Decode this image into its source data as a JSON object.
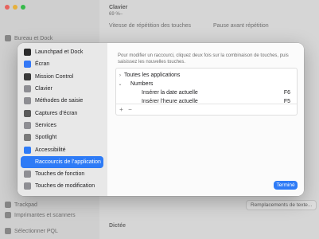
{
  "background": {
    "sidebar_items": [
      "Bureau et Dock",
      "Trackpad",
      "Imprimantes et scanners",
      "Sélectionner PQL"
    ],
    "main_title": "Clavier",
    "main_subtitle": "69 % ̶",
    "label_repeat": "Vitesse de répétition des touches",
    "label_delay": "Pause avant répétition",
    "button_replacements": "Remplacements de texte...",
    "section_dictation": "Dictée"
  },
  "dialog": {
    "sidebar": [
      {
        "label": "Launchpad et Dock",
        "icon": "launchpad-dock-icon",
        "color": "#2b2b2b"
      },
      {
        "label": "Écran",
        "icon": "display-icon",
        "color": "#3478f6"
      },
      {
        "label": "Mission Control",
        "icon": "mission-control-icon",
        "color": "#3a3a3a"
      },
      {
        "label": "Clavier",
        "icon": "keyboard-icon",
        "color": "#8e8e93"
      },
      {
        "label": "Méthodes de saisie",
        "icon": "input-methods-icon",
        "color": "#8e8e93"
      },
      {
        "label": "Captures d’écran",
        "icon": "screenshot-icon",
        "color": "#5a5a5a"
      },
      {
        "label": "Services",
        "icon": "gear-icon",
        "color": "#8e8e93"
      },
      {
        "label": "Spotlight",
        "icon": "spotlight-icon",
        "color": "#7a7a7a"
      },
      {
        "label": "Accessibilité",
        "icon": "accessibility-icon",
        "color": "#2e7bf6"
      },
      {
        "label": "Raccourcis de l’application",
        "icon": "app-shortcuts-icon",
        "color": "#2e7bf6",
        "selected": true
      },
      {
        "label": "Touches de fonction",
        "icon": "function-keys-icon",
        "color": "#8e8e93"
      },
      {
        "label": "Touches de modification",
        "icon": "modifier-keys-icon",
        "color": "#8e8e93"
      }
    ],
    "description": "Pour modifier un raccourci, cliquez deux fois sur la combinaison de touches, puis saisissez les nouvelles touches.",
    "rows": [
      {
        "label": "Toutes les applications",
        "chevron": "›",
        "key": ""
      },
      {
        "label": "Numbers",
        "chevron": "⌄",
        "key": ""
      },
      {
        "label": "Insérer la date actuelle",
        "chevron": "",
        "key": "F6"
      },
      {
        "label": "Insérer l’heure actuelle",
        "chevron": "",
        "key": "F5"
      }
    ],
    "add_label": "+",
    "remove_label": "−",
    "done_label": "Terminé"
  }
}
